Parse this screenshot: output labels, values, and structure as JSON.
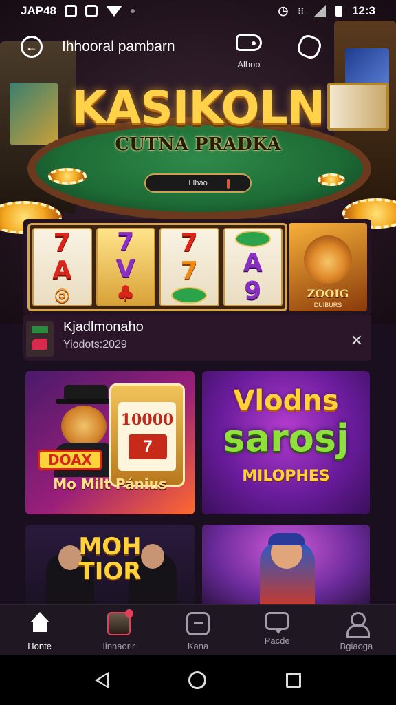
{
  "status_bar": {
    "carrier": "JAP48",
    "time": "12:3"
  },
  "header": {
    "title": "Ihhooral pambarn",
    "tag_label": "Alhoo"
  },
  "hero": {
    "logo_title": "KASIKOLN",
    "logo_subtitle": "CUTNA PRADKA",
    "table_bar_text": "I Ihao"
  },
  "reel_banner": {
    "reels": [
      [
        "7",
        "A",
        "◎"
      ],
      [
        "7",
        "V",
        "♣"
      ],
      [
        "7",
        "7",
        "◎"
      ],
      [
        "◎",
        "A",
        "9"
      ]
    ],
    "lion_tile": {
      "title": "ZOOIG",
      "subtitle": "DUIBURS"
    }
  },
  "info_row": {
    "title": "Kjadlmonaho",
    "subtitle": "Yiodots:2029"
  },
  "games": [
    {
      "badge": "DOAX",
      "jackpot": "10000",
      "seven": "7",
      "caption": "Mo Milt Pánius"
    },
    {
      "line1": "Vlodns",
      "line2": "sarosj",
      "line3": "MILOPHES"
    },
    {
      "title": "MOH\nTIOR"
    },
    {}
  ],
  "bottom_nav": {
    "items": [
      {
        "label": "Honte",
        "icon": "home-icon",
        "active": true
      },
      {
        "label": "Iinnaorir",
        "icon": "avatar-icon",
        "active": false
      },
      {
        "label": "Kana",
        "icon": "game-icon",
        "active": false
      },
      {
        "label": "Pacde",
        "icon": "chat-icon",
        "active": false
      },
      {
        "label": "Bgiaoga",
        "icon": "profile-icon",
        "active": false
      }
    ]
  },
  "colors": {
    "accent_gold": "#ffd23a",
    "background": "#1a0f1e",
    "nav_bar": "#1f1822"
  }
}
